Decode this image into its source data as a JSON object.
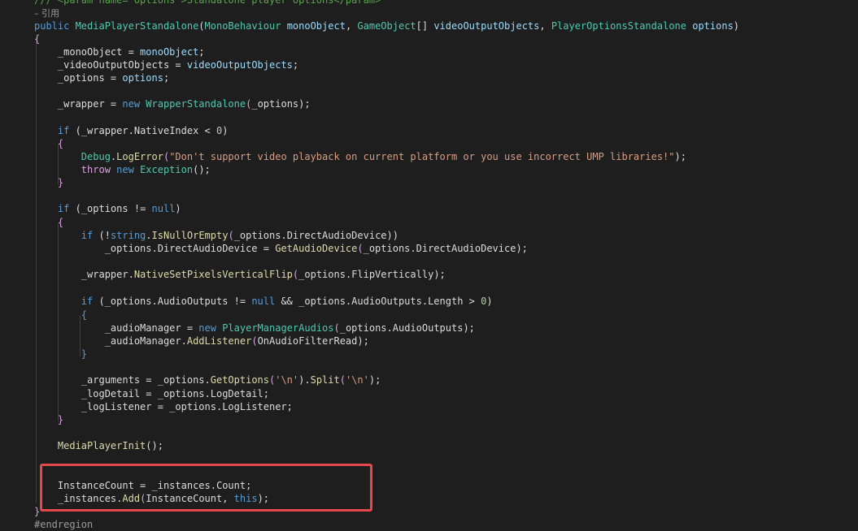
{
  "highlight": {
    "color": "#e5484d",
    "label": ""
  },
  "lines": [
    [
      {
        "t": "/// <param name=\"options\">Standalone player options</param>",
        "c": "cmt"
      }
    ],
    [
      {
        "t": "– 引用",
        "c": "lens"
      }
    ],
    [
      {
        "t": "public ",
        "c": "kw"
      },
      {
        "t": "MediaPlayerStandalone",
        "c": "typ"
      },
      {
        "t": "(",
        "c": "txt"
      },
      {
        "t": "MonoBehaviour ",
        "c": "typ"
      },
      {
        "t": "monoObject",
        "c": "var"
      },
      {
        "t": ", ",
        "c": "txt"
      },
      {
        "t": "GameObject",
        "c": "typ"
      },
      {
        "t": "[] ",
        "c": "txt"
      },
      {
        "t": "videoOutputObjects",
        "c": "var"
      },
      {
        "t": ", ",
        "c": "txt"
      },
      {
        "t": "PlayerOptionsStandalone ",
        "c": "typ"
      },
      {
        "t": "options",
        "c": "var"
      },
      {
        "t": ")",
        "c": "txt"
      }
    ],
    [
      {
        "t": "{",
        "c": "ctl"
      }
    ],
    [],
    [
      {
        "t": "    _monoObject = ",
        "c": "txt"
      },
      {
        "t": "monoObject",
        "c": "var"
      },
      {
        "t": ";",
        "c": "txt"
      }
    ],
    [
      {
        "t": "    _videoOutputObjects = ",
        "c": "txt"
      },
      {
        "t": "videoOutputObjects",
        "c": "var"
      },
      {
        "t": ";",
        "c": "txt"
      }
    ],
    [
      {
        "t": "    _options = ",
        "c": "txt"
      },
      {
        "t": "options",
        "c": "var"
      },
      {
        "t": ";",
        "c": "txt"
      }
    ],
    [],
    [
      {
        "t": "    _wrapper = ",
        "c": "txt"
      },
      {
        "t": "new ",
        "c": "kw"
      },
      {
        "t": "WrapperStandalone",
        "c": "typ"
      },
      {
        "t": "(",
        "c": "ctl"
      },
      {
        "t": "_options",
        "c": "txt"
      },
      {
        "t": ");",
        "c": "txt"
      }
    ],
    [],
    [
      {
        "t": "    ",
        "c": "txt"
      },
      {
        "t": "if ",
        "c": "kw"
      },
      {
        "t": "(_wrapper.NativeIndex < ",
        "c": "txt"
      },
      {
        "t": "0",
        "c": "num"
      },
      {
        "t": ")",
        "c": "txt"
      }
    ],
    [
      {
        "t": "    {",
        "c": "ctl"
      }
    ],
    [
      {
        "t": "        ",
        "c": "txt"
      },
      {
        "t": "Debug",
        "c": "typ"
      },
      {
        "t": ".",
        "c": "txt"
      },
      {
        "t": "LogError",
        "c": "fn"
      },
      {
        "t": "(",
        "c": "ctl"
      },
      {
        "t": "\"Don't support video playback on current platform or you use incorrect UMP libraries!\"",
        "c": "str"
      },
      {
        "t": ");",
        "c": "txt"
      }
    ],
    [
      {
        "t": "        ",
        "c": "txt"
      },
      {
        "t": "throw ",
        "c": "ctl"
      },
      {
        "t": "new ",
        "c": "kw"
      },
      {
        "t": "Exception",
        "c": "typ"
      },
      {
        "t": "();",
        "c": "txt"
      }
    ],
    [
      {
        "t": "    }",
        "c": "ctl"
      }
    ],
    [],
    [
      {
        "t": "    ",
        "c": "txt"
      },
      {
        "t": "if ",
        "c": "kw"
      },
      {
        "t": "(_options != ",
        "c": "txt"
      },
      {
        "t": "null",
        "c": "kw"
      },
      {
        "t": ")",
        "c": "txt"
      }
    ],
    [
      {
        "t": "    {",
        "c": "ctl"
      }
    ],
    [
      {
        "t": "        ",
        "c": "txt"
      },
      {
        "t": "if ",
        "c": "kw"
      },
      {
        "t": "(!",
        "c": "txt"
      },
      {
        "t": "string",
        "c": "kw"
      },
      {
        "t": ".",
        "c": "txt"
      },
      {
        "t": "IsNullOrEmpty",
        "c": "fn"
      },
      {
        "t": "(",
        "c": "ctl"
      },
      {
        "t": "_options.DirectAudioDevice",
        "c": "txt"
      },
      {
        "t": "))",
        "c": "txt"
      }
    ],
    [
      {
        "t": "            _options.DirectAudioDevice = ",
        "c": "txt"
      },
      {
        "t": "GetAudioDevice",
        "c": "fn"
      },
      {
        "t": "(",
        "c": "ctl"
      },
      {
        "t": "_options.DirectAudioDevice",
        "c": "txt"
      },
      {
        "t": ");",
        "c": "txt"
      }
    ],
    [],
    [
      {
        "t": "        _wrapper.",
        "c": "txt"
      },
      {
        "t": "NativeSetPixelsVerticalFlip",
        "c": "fn"
      },
      {
        "t": "(",
        "c": "ctl"
      },
      {
        "t": "_options.FlipVertically",
        "c": "txt"
      },
      {
        "t": ");",
        "c": "txt"
      }
    ],
    [],
    [
      {
        "t": "        ",
        "c": "txt"
      },
      {
        "t": "if ",
        "c": "kw"
      },
      {
        "t": "(_options.AudioOutputs != ",
        "c": "txt"
      },
      {
        "t": "null ",
        "c": "kw"
      },
      {
        "t": "&& _options.AudioOutputs.Length > ",
        "c": "txt"
      },
      {
        "t": "0",
        "c": "num"
      },
      {
        "t": ")",
        "c": "txt"
      }
    ],
    [
      {
        "t": "        {",
        "c": "kw"
      }
    ],
    [
      {
        "t": "            _audioManager = ",
        "c": "txt"
      },
      {
        "t": "new ",
        "c": "kw"
      },
      {
        "t": "PlayerManagerAudios",
        "c": "typ"
      },
      {
        "t": "(",
        "c": "ctl"
      },
      {
        "t": "_options.AudioOutputs",
        "c": "txt"
      },
      {
        "t": ");",
        "c": "txt"
      }
    ],
    [
      {
        "t": "            _audioManager.",
        "c": "txt"
      },
      {
        "t": "AddListener",
        "c": "fn"
      },
      {
        "t": "(",
        "c": "ctl"
      },
      {
        "t": "OnAudioFilterRead",
        "c": "txt"
      },
      {
        "t": ");",
        "c": "txt"
      }
    ],
    [
      {
        "t": "        }",
        "c": "kw"
      }
    ],
    [],
    [
      {
        "t": "        _arguments = _options.",
        "c": "txt"
      },
      {
        "t": "GetOptions",
        "c": "fn"
      },
      {
        "t": "(",
        "c": "ctl"
      },
      {
        "t": "'\\n'",
        "c": "str"
      },
      {
        "t": ").",
        "c": "txt"
      },
      {
        "t": "Split",
        "c": "fn"
      },
      {
        "t": "(",
        "c": "ctl"
      },
      {
        "t": "'\\n'",
        "c": "str"
      },
      {
        "t": ");",
        "c": "txt"
      }
    ],
    [
      {
        "t": "        _logDetail = _options.LogDetail;",
        "c": "txt"
      }
    ],
    [
      {
        "t": "        _logListener = _options.LogListener;",
        "c": "txt"
      }
    ],
    [
      {
        "t": "    }",
        "c": "ctl"
      }
    ],
    [],
    [
      {
        "t": "    ",
        "c": "txt"
      },
      {
        "t": "MediaPlayerInit",
        "c": "fn"
      },
      {
        "t": "();",
        "c": "txt"
      }
    ],
    [],
    [],
    [
      {
        "t": "    InstanceCount = _instances.Count;",
        "c": "txt"
      }
    ],
    [
      {
        "t": "    _instances.",
        "c": "txt"
      },
      {
        "t": "Add",
        "c": "fn"
      },
      {
        "t": "(",
        "c": "ctl"
      },
      {
        "t": "InstanceCount, ",
        "c": "txt"
      },
      {
        "t": "this",
        "c": "kw"
      },
      {
        "t": ");",
        "c": "txt"
      }
    ],
    [
      {
        "t": "}",
        "c": "ctl"
      }
    ],
    [
      {
        "t": "#endregion",
        "c": "pp"
      }
    ]
  ]
}
